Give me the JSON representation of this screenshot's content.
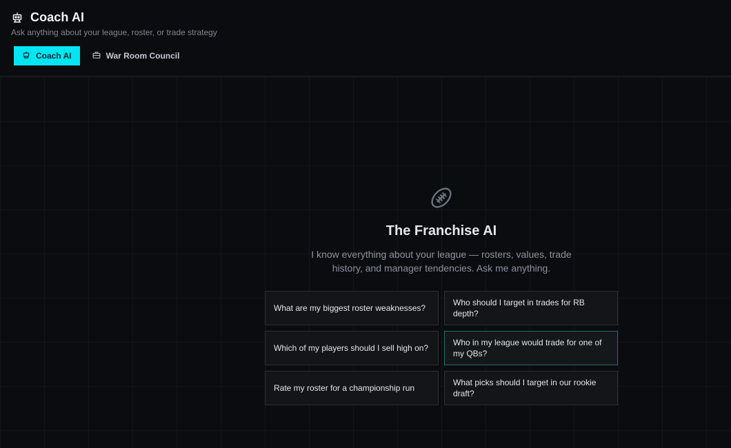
{
  "header": {
    "icon": "robot-icon",
    "title": "Coach AI",
    "subtitle": "Ask anything about your league, roster, or trade strategy"
  },
  "tabs": [
    {
      "label": "Coach AI",
      "icon": "robot-icon",
      "active": true
    },
    {
      "label": "War Room Council",
      "icon": "briefcase-icon",
      "active": false
    }
  ],
  "hero": {
    "icon": "football-icon",
    "title": "The Franchise AI",
    "description": "I know everything about your league — rosters, values, trade history, and manager tendencies. Ask me anything."
  },
  "prompts": [
    "What are my biggest roster weaknesses?",
    "Who should I target in trades for RB depth?",
    "Which of my players should I sell high on?",
    "Who in my league would trade for one of my QBs?",
    "Rate my roster for a championship run",
    "What picks should I target in our rookie draft?"
  ],
  "colors": {
    "accent": "#00e5f2",
    "background": "#0b0c0f",
    "card": "#141518"
  }
}
